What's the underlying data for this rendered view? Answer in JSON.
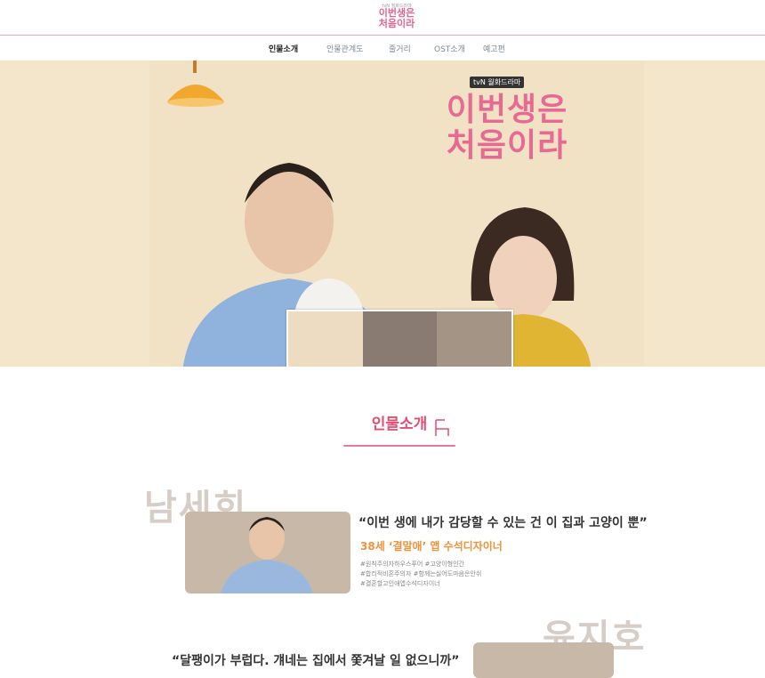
{
  "header": {
    "logo_small": "tvN 월화드라마",
    "logo_line1": "이번생은",
    "logo_line2": "처음이라"
  },
  "nav": {
    "items": [
      {
        "label": "인물소개",
        "active": true
      },
      {
        "label": "인물관계도",
        "active": false
      },
      {
        "label": "줄거리",
        "active": false
      },
      {
        "label": "OST소개",
        "active": false
      },
      {
        "label": "예고편",
        "active": false
      }
    ]
  },
  "hero": {
    "channel_badge": "tvN 월화드라마",
    "title_line1": "이번생은",
    "title_line2": "처음이라"
  },
  "section": {
    "title": "인물소개"
  },
  "characters": [
    {
      "name": "남세희",
      "quote": "“이번 생에 내가 감당할 수 있는 건 이 집과 고양이 뿐”",
      "role": "38세 ‘결말애’ 앱 수석디자이너",
      "tags": [
        "#원칙주의자하우스푸어 #고양이형인간",
        "#합리적비혼주의자 #함께는싫어도마음은안쉬",
        "#결혼할고인애앱수석디자이너"
      ]
    },
    {
      "name": "윤지호",
      "quote": "“달팽이가 부럽다. 걔네는 집에서 쫓겨날 일 없으니까”"
    }
  ],
  "colors": {
    "accent_pink": "#e24d74",
    "role_orange": "#f0923c",
    "nav_line": "#f0a6c0",
    "hero_bg": "#f3e6cb"
  }
}
